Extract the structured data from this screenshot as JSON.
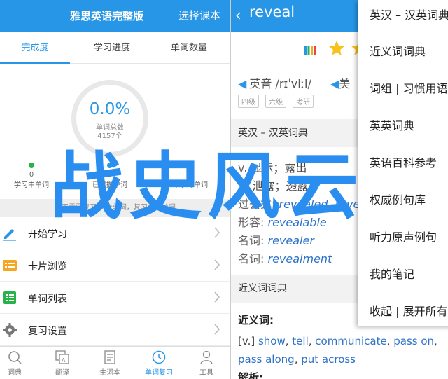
{
  "left": {
    "header": {
      "title": "雅思英语完整版",
      "action": "选择课本"
    },
    "tabs": [
      {
        "label": "完成度",
        "active": true
      },
      {
        "label": "学习进度",
        "active": false
      },
      {
        "label": "单词数量",
        "active": false
      }
    ],
    "ring": {
      "percent": "0.0%",
      "label": "单词总数",
      "count": "4157个"
    },
    "stats": [
      {
        "num": "0",
        "label": "学习中单词",
        "color": "#27b24a"
      },
      {
        "num": "0",
        "label": "已掌握单词",
        "color": "#2896e6"
      },
      {
        "num": "0",
        "label": "未学习单词",
        "color": "#dddddd"
      }
    ],
    "notice": "今天需要复习30个单词，复习全部单词",
    "menu": [
      {
        "label": "开始学习",
        "icon": "pencil-icon",
        "color": "#2896e6"
      },
      {
        "label": "卡片浏览",
        "icon": "cards-icon",
        "color": "#f5a623"
      },
      {
        "label": "单词列表",
        "icon": "list-icon",
        "color": "#27b24a"
      },
      {
        "label": "复习设置",
        "icon": "gear-icon",
        "color": "#777777"
      }
    ],
    "tabbar": [
      {
        "label": "词典",
        "icon": "search-icon",
        "active": false
      },
      {
        "label": "翻译",
        "icon": "translate-icon",
        "active": false
      },
      {
        "label": "生词本",
        "icon": "notebook-icon",
        "active": false
      },
      {
        "label": "单词复习",
        "icon": "clock-icon",
        "active": true
      },
      {
        "label": "工具",
        "icon": "person-icon",
        "active": false
      }
    ]
  },
  "right": {
    "header": {
      "back": "‹",
      "word": "reveal"
    },
    "pron": {
      "uk_label": "英音",
      "uk_ipa": "/rɪˈviːl/",
      "us_label": "美"
    },
    "tags": [
      "四级",
      "六级",
      "考研"
    ],
    "section1": "英汉 – 汉英词典",
    "defs": [
      {
        "pos": "v.",
        "text": "显示；露出"
      },
      {
        "pos": "2.",
        "text": "泄露；透露"
      },
      {
        "pos": "过去式:",
        "text": "revealed, revealed"
      },
      {
        "pos": "形容:",
        "text": "revealable"
      },
      {
        "pos": "名词:",
        "text": "revealer"
      },
      {
        "pos": "名词:",
        "text": "revealment"
      }
    ],
    "section2": "近义词词典",
    "synonyms": {
      "title": "近义词:",
      "pos": "[v.]",
      "items": [
        "show",
        "tell",
        "communicate",
        "pass on",
        "pass along",
        "put across"
      ]
    },
    "next_title": "解析:"
  },
  "popup": {
    "items": [
      "英汉 – 汉英词典",
      "近义词词典",
      "词组 | 习惯用语",
      "英英词典",
      "英语百科参考",
      "权威例句库",
      "听力原声例句",
      "我的笔记",
      "收起 | 展开所有"
    ]
  },
  "watermark": "战史风云",
  "colors": {
    "brand": "#2896e6",
    "link": "#2d72c8"
  }
}
